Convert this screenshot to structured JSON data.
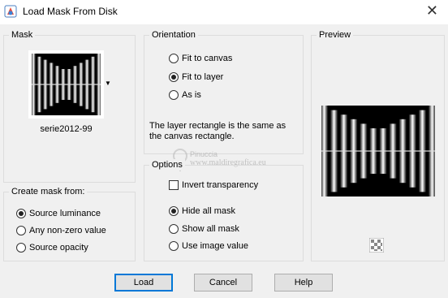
{
  "window": {
    "title": "Load Mask From Disk",
    "close_glyph": "✕",
    "app_icon": "psp-icon"
  },
  "mask_group": {
    "legend": "Mask",
    "mask_name": "serie2012-99",
    "dropdown_glyph": "▼"
  },
  "orientation_group": {
    "legend": "Orientation",
    "options": [
      {
        "label": "Fit to canvas",
        "checked": false
      },
      {
        "label": "Fit to layer",
        "checked": true
      },
      {
        "label": "As is",
        "checked": false
      }
    ],
    "info": "The layer rectangle is the same as the canvas rectangle."
  },
  "options_group": {
    "legend": "Options",
    "invert_label": "Invert transparency",
    "invert_checked": false,
    "options": [
      {
        "label": "Hide all mask",
        "checked": true
      },
      {
        "label": "Show all mask",
        "checked": false
      },
      {
        "label": "Use image value",
        "checked": false
      }
    ]
  },
  "create_group": {
    "legend": "Create mask from:",
    "options": [
      {
        "label": "Source luminance",
        "checked": true
      },
      {
        "label": "Any non-zero value",
        "checked": false
      },
      {
        "label": "Source opacity",
        "checked": false
      }
    ]
  },
  "preview_group": {
    "legend": "Preview"
  },
  "watermark": {
    "line1": "Pinuccia",
    "line2": "www.maldiregrafica.eu"
  },
  "buttons": {
    "load": "Load",
    "cancel": "Cancel",
    "help": "Help"
  },
  "colors": {
    "accent": "#0078d7",
    "background": "#f0f0f0"
  }
}
